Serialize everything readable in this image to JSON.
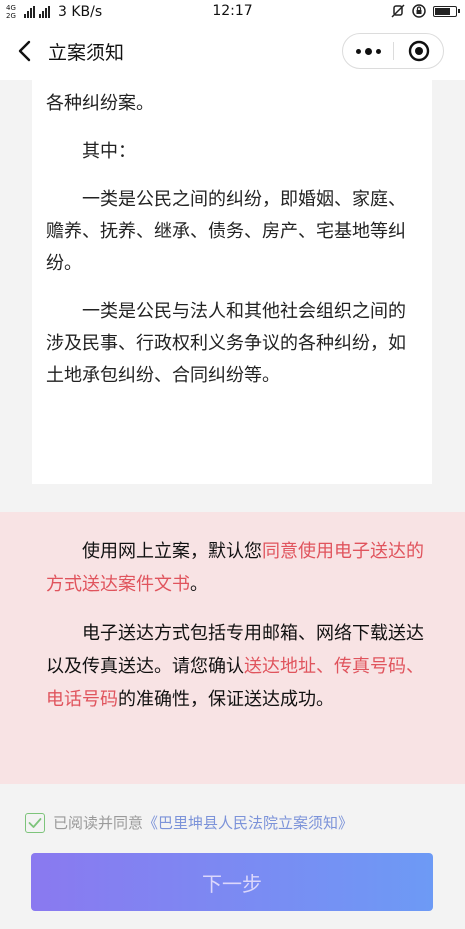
{
  "status_bar": {
    "net_tags": "4G 2G",
    "speed": "3 KB/s",
    "time": "12:17"
  },
  "nav": {
    "title": "立案须知"
  },
  "card": {
    "p1": "社会组织之间涉及民事、行政权利义务争议的各种纠纷案。",
    "p2": "其中：",
    "p3": "一类是公民之间的纠纷，即婚姻、家庭、赡养、抚养、继承、债务、房产、宅基地等纠纷。",
    "p4": "一类是公民与法人和其他社会组织之间的涉及民事、行政权利义务争议的各种纠纷，如土地承包纠纷、合同纠纷等。"
  },
  "notice": {
    "p1_a": "使用网上立案，默认您",
    "p1_red": "同意使用电子送达的方式送达案件文书",
    "p1_b": "。",
    "p2_a": "电子送达方式包括专用邮箱、网络下载送达以及传真送达。请您确认",
    "p2_red": "送达地址、传真号码、电话号码",
    "p2_b": "的准确性，保证送达成功。"
  },
  "agree": {
    "text": "已阅读并同意",
    "link": "《巴里坤县人民法院立案须知》"
  },
  "button": {
    "next": "下一步"
  },
  "colors": {
    "accent_red": "#e0545d",
    "link_blue": "#7c93d9",
    "check_green": "#7dc47b",
    "notice_bg": "#f8e3e4"
  }
}
